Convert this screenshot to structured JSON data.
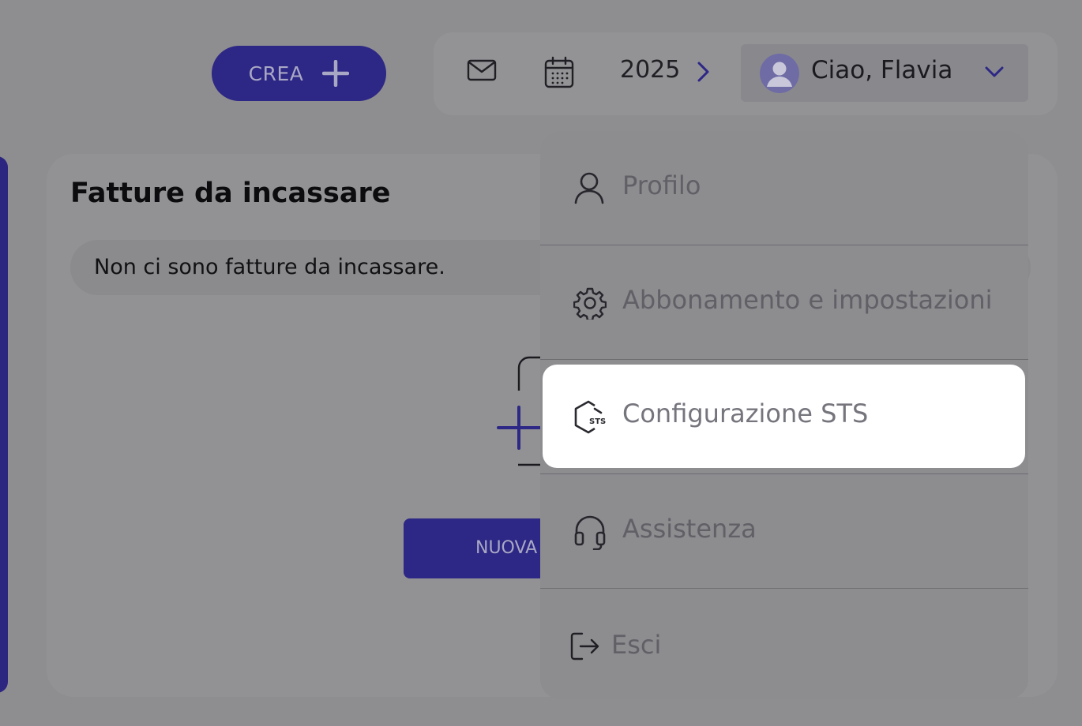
{
  "toolbar": {
    "create_label": "CREA",
    "year": "2025",
    "greeting": "Ciao, Flavia"
  },
  "card": {
    "title": "Fatture da incassare",
    "empty_message": "Non ci sono fatture da incassare.",
    "new_button_label": "NUOVA"
  },
  "user_menu": {
    "items": [
      {
        "label": "Profilo",
        "icon": "user-icon"
      },
      {
        "label": "Abbonamento e impostazioni",
        "icon": "gear-icon"
      },
      {
        "label": "Configurazione STS",
        "icon": "sts-icon",
        "icon_text": "STS"
      },
      {
        "label": "Assistenza",
        "icon": "headset-icon"
      },
      {
        "label": "Esci",
        "icon": "logout-icon"
      }
    ]
  },
  "colors": {
    "brand": "#2d2785",
    "overlay_background": "#8e8e91",
    "highlight": "#ffffff"
  }
}
